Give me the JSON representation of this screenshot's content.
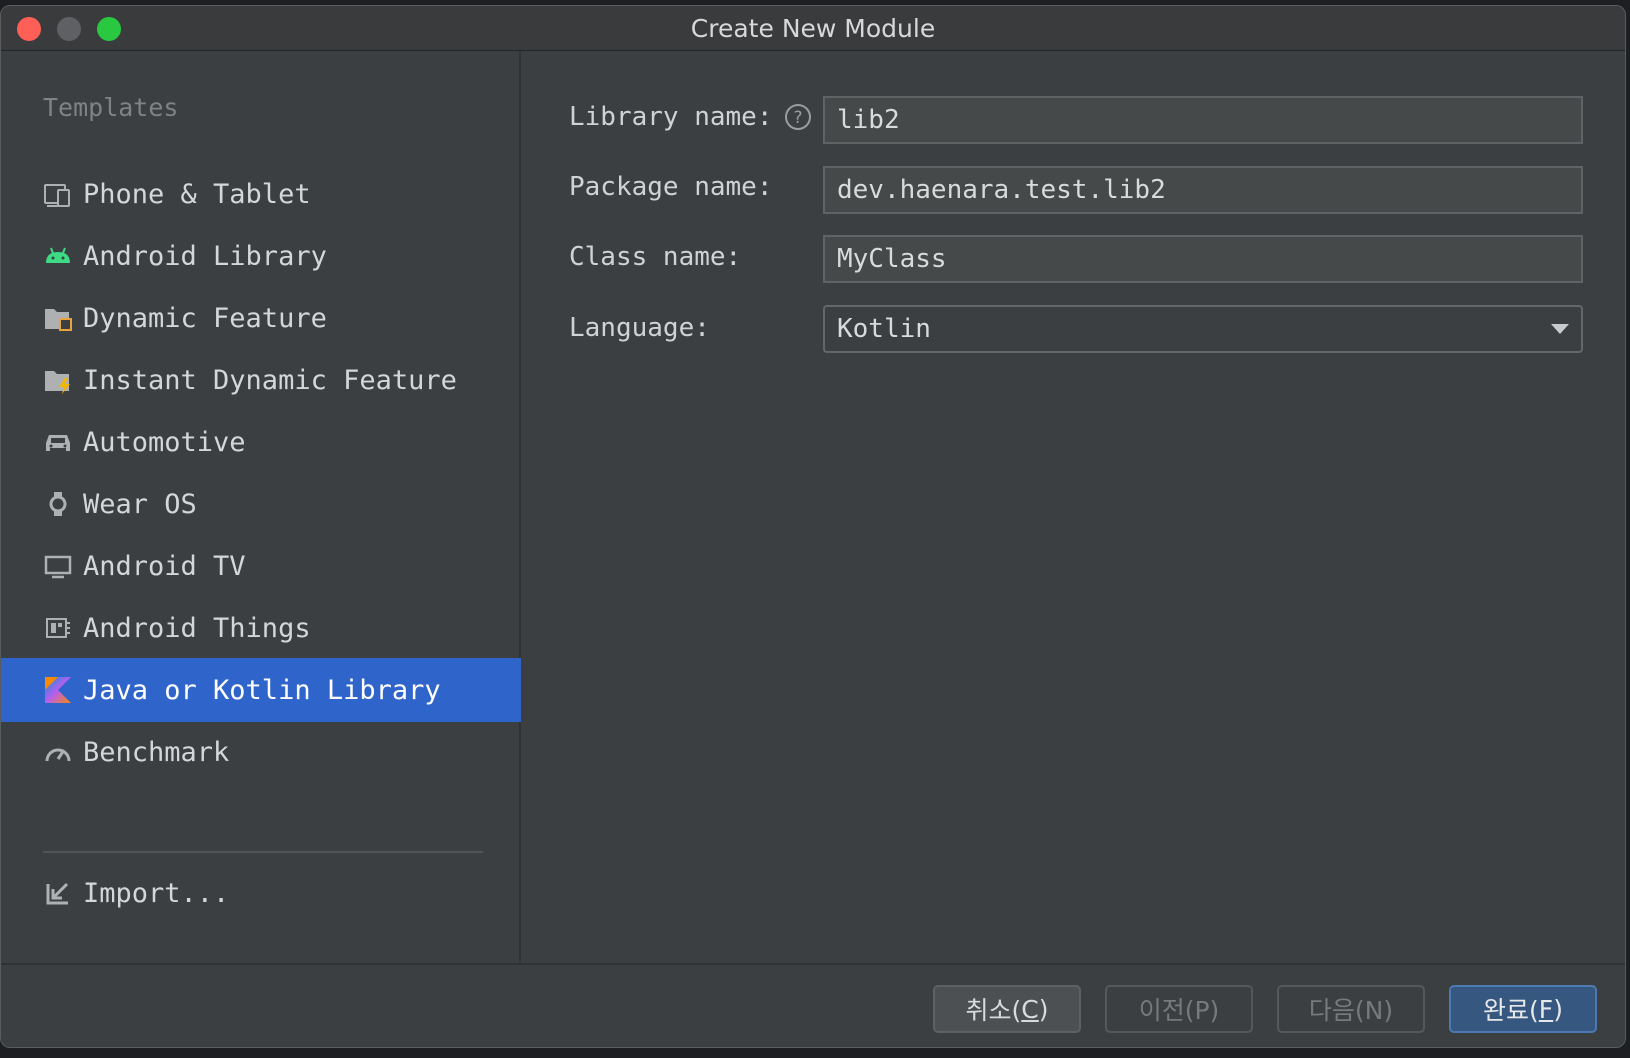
{
  "window": {
    "title": "Create New Module"
  },
  "sidebar": {
    "header": "Templates",
    "items": [
      {
        "label": "Phone & Tablet",
        "icon": "phone-tablet-icon"
      },
      {
        "label": "Android Library",
        "icon": "android-icon"
      },
      {
        "label": "Dynamic Feature",
        "icon": "dynamic-feature-icon"
      },
      {
        "label": "Instant Dynamic Feature",
        "icon": "instant-feature-icon"
      },
      {
        "label": "Automotive",
        "icon": "car-icon"
      },
      {
        "label": "Wear OS",
        "icon": "watch-icon"
      },
      {
        "label": "Android TV",
        "icon": "tv-icon"
      },
      {
        "label": "Android Things",
        "icon": "things-icon"
      },
      {
        "label": "Java or Kotlin Library",
        "icon": "kotlin-icon",
        "selected": true
      },
      {
        "label": "Benchmark",
        "icon": "gauge-icon"
      }
    ],
    "import_label": "Import..."
  },
  "form": {
    "library_name": {
      "label": "Library name:",
      "value": "lib2"
    },
    "package_name": {
      "label": "Package name:",
      "value": "dev.haenara.test.lib2"
    },
    "class_name": {
      "label": "Class name:",
      "value": "MyClass"
    },
    "language": {
      "label": "Language:",
      "value": "Kotlin"
    }
  },
  "footer": {
    "cancel": {
      "text": "취소(",
      "mnemonic": "C",
      "end": ")"
    },
    "previous": {
      "text": "이전(P)"
    },
    "next": {
      "text": "다음(N)"
    },
    "finish": {
      "text": "완료(",
      "mnemonic": "F",
      "end": ")"
    }
  },
  "colors": {
    "selection": "#2f65ca",
    "primary_button": "#365880",
    "traffic_close": "#fe5f57",
    "traffic_max": "#2ac840"
  }
}
